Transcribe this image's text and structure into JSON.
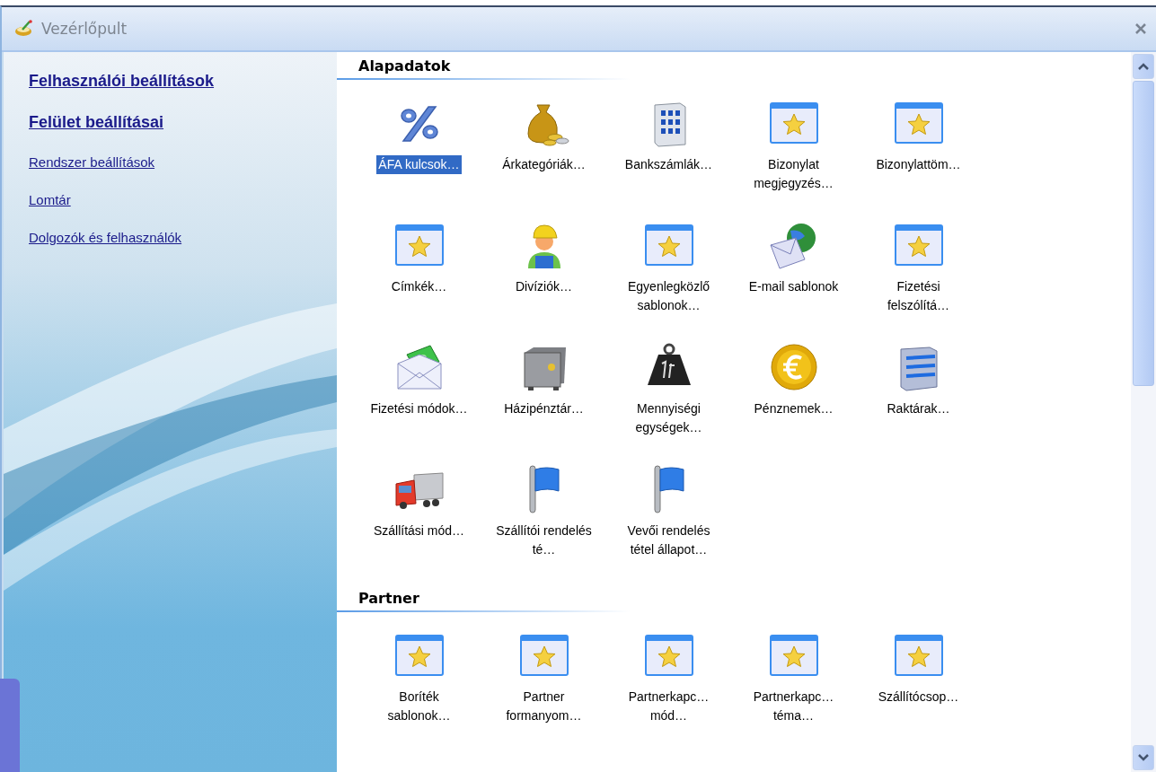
{
  "window": {
    "title": "Vezérlőpult"
  },
  "sidebar": {
    "links": [
      {
        "label": "Felhasználói beállítások",
        "bold": true
      },
      {
        "label": "Felület beállításai",
        "bold": true
      },
      {
        "label": "Rendszer beállítások",
        "bold": false
      },
      {
        "label": "Lomtár",
        "bold": false
      },
      {
        "label": "Dolgozók és felhasználók",
        "bold": false
      }
    ]
  },
  "sections": [
    {
      "title": "Alapadatok",
      "items": [
        {
          "label": "ÁFA kulcsok…",
          "kind": "percent",
          "selected": true
        },
        {
          "label": "Árkategóriák…",
          "kind": "moneybag",
          "selected": false
        },
        {
          "label": "Bankszámlák…",
          "kind": "building",
          "selected": false
        },
        {
          "label": "Bizonylat megjegyzés…",
          "kind": "window",
          "selected": false
        },
        {
          "label": "Bizonylattöm…",
          "kind": "window",
          "selected": false
        },
        {
          "label": "Címkék…",
          "kind": "window",
          "selected": false
        },
        {
          "label": "Divíziók…",
          "kind": "worker",
          "selected": false
        },
        {
          "label": "Egyenlegközlő sablonok…",
          "kind": "window",
          "selected": false
        },
        {
          "label": "E-mail sablonok",
          "kind": "mailglobe",
          "selected": false
        },
        {
          "label": "Fizetési felszólítá…",
          "kind": "window",
          "selected": false
        },
        {
          "label": "Fizetési módok…",
          "kind": "mailmoney",
          "selected": false
        },
        {
          "label": "Házipénztár…",
          "kind": "safe",
          "selected": false
        },
        {
          "label": "Mennyiségi egységek…",
          "kind": "weight",
          "selected": false
        },
        {
          "label": "Pénznemek…",
          "kind": "coin",
          "selected": false
        },
        {
          "label": "Raktárak…",
          "kind": "stack",
          "selected": false
        },
        {
          "label": "Szállítási mód…",
          "kind": "truck",
          "selected": false
        },
        {
          "label": "Szállítói rendelés té…",
          "kind": "flag",
          "selected": false
        },
        {
          "label": "Vevői rendelés tétel állapot…",
          "kind": "flag",
          "selected": false
        }
      ]
    },
    {
      "title": "Partner",
      "items": [
        {
          "label": "Boríték sablonok…",
          "kind": "window",
          "selected": false
        },
        {
          "label": "Partner formanyom…",
          "kind": "window",
          "selected": false
        },
        {
          "label": "Partnerkapc… mód…",
          "kind": "window",
          "selected": false
        },
        {
          "label": "Partnerkapc… téma…",
          "kind": "window",
          "selected": false
        },
        {
          "label": "Szállítócsop…",
          "kind": "window",
          "selected": false
        }
      ]
    }
  ]
}
